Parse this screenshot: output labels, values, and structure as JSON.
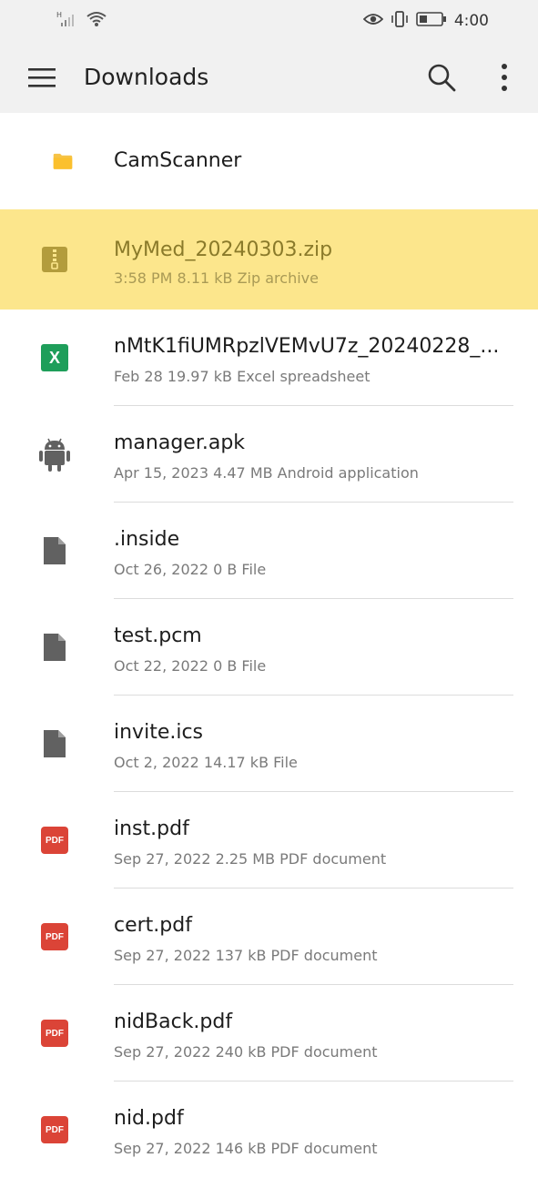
{
  "status_bar": {
    "time": "4:00",
    "signal_label": "H"
  },
  "app_bar": {
    "title": "Downloads",
    "menu_icon": "hamburger-menu-icon",
    "search_icon": "search-icon",
    "more_icon": "more-vert-icon"
  },
  "files": [
    {
      "name": "CamScanner",
      "meta": "",
      "icon": "folder-icon"
    },
    {
      "name": "MyMed_20240303.zip",
      "meta": "3:58 PM 8.11 kB Zip archive",
      "icon": "zip-icon"
    },
    {
      "name": "nMtK1fiUMRpzlVEMvU7z_20240228_...",
      "meta": "Feb 28 19.97 kB Excel spreadsheet",
      "icon": "excel-icon"
    },
    {
      "name": "manager.apk",
      "meta": "Apr 15, 2023 4.47 MB Android application",
      "icon": "android-icon"
    },
    {
      "name": ".inside",
      "meta": "Oct 26, 2022 0 B File",
      "icon": "file-icon"
    },
    {
      "name": "test.pcm",
      "meta": "Oct 22, 2022 0 B File",
      "icon": "file-icon"
    },
    {
      "name": "invite.ics",
      "meta": "Oct 2, 2022 14.17 kB File",
      "icon": "file-icon"
    },
    {
      "name": "inst.pdf",
      "meta": "Sep 27, 2022 2.25 MB PDF document",
      "icon": "pdf-icon"
    },
    {
      "name": "cert.pdf",
      "meta": "Sep 27, 2022 137 kB PDF document",
      "icon": "pdf-icon"
    },
    {
      "name": "nidBack.pdf",
      "meta": "Sep 27, 2022 240 kB PDF document",
      "icon": "pdf-icon"
    },
    {
      "name": "nid.pdf",
      "meta": "Sep 27, 2022 146 kB PDF document",
      "icon": "pdf-icon"
    }
  ],
  "badges": {
    "pdf_label": "PDF",
    "excel_label": "X"
  },
  "colors": {
    "highlight": "#fce68c",
    "folder": "#fbc02d",
    "pdf": "#db4437",
    "excel": "#1e9e5a"
  }
}
